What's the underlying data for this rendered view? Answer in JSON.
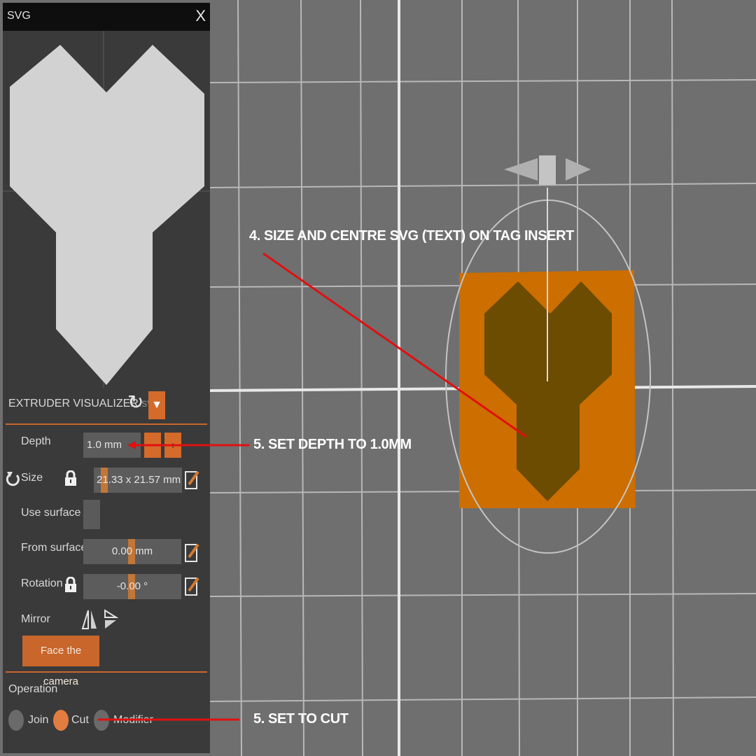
{
  "panel": {
    "title": "SVG",
    "close_label": "X",
    "file_name": "EXTRUDER VISUALIZER",
    "file_ext": ".svg",
    "dropdown_glyph": "▼",
    "reload_icon": "↻",
    "depth": {
      "label": "Depth",
      "value": "1.0 mm"
    },
    "size": {
      "label": "Size",
      "value": "21.33 x 21.57 mm"
    },
    "use_surface": {
      "label": "Use surface"
    },
    "from_surface": {
      "label": "From surface",
      "value": "0.00 mm"
    },
    "rotation": {
      "label": "Rotation",
      "value": "-0.00 °"
    },
    "mirror": {
      "label": "Mirror"
    },
    "face_camera_label": "Face the camera",
    "operation": {
      "label": "Operation",
      "options": [
        "Join",
        "Cut",
        "Modifier"
      ],
      "selected": "Cut"
    }
  },
  "annotations": {
    "size_centre": "4. SIZE AND CENTRE SVG (TEXT) ON TAG INSERT",
    "set_depth": "5. SET DEPTH TO 1.0MM",
    "set_cut": "5. SET TO CUT"
  },
  "colors": {
    "accent": "#d46b2a",
    "panel_bg": "#3a3a3a",
    "title_bg": "#0e0e0e",
    "viewport_bg": "#6f6f6f",
    "tag_orange": "#cc6e00",
    "shape_dark": "#6b4c00",
    "preview_shape": "#d2d2d2",
    "arrow_red": "#e01010"
  }
}
